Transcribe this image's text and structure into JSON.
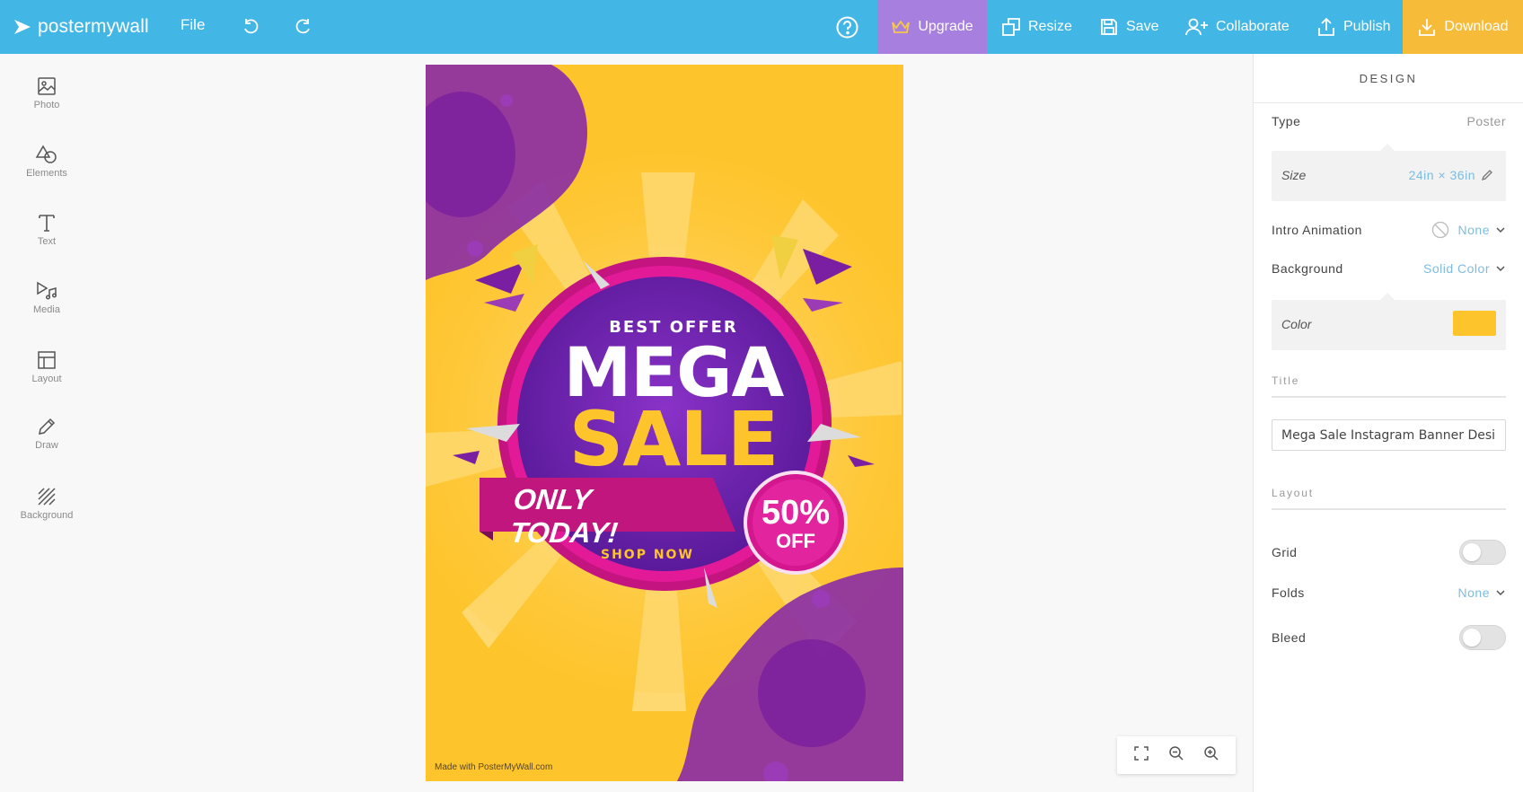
{
  "app": {
    "brand": "postermywall",
    "file_menu": "File"
  },
  "toolbar": {
    "upgrade": "Upgrade",
    "resize": "Resize",
    "save": "Save",
    "collaborate": "Collaborate",
    "publish": "Publish",
    "download": "Download"
  },
  "sidebar": {
    "items": [
      {
        "label": "Photo",
        "icon": "image-icon"
      },
      {
        "label": "Elements",
        "icon": "shapes-icon"
      },
      {
        "label": "Text",
        "icon": "text-icon"
      },
      {
        "label": "Media",
        "icon": "media-icon"
      },
      {
        "label": "Layout",
        "icon": "layout-icon"
      },
      {
        "label": "Draw",
        "icon": "pencil-icon"
      },
      {
        "label": "Background",
        "icon": "background-pattern-icon"
      }
    ]
  },
  "poster": {
    "best_offer": "BEST OFFER",
    "mega": "MEGA",
    "sale": "SALE",
    "only_today": "ONLY TODAY!",
    "percent": "50%",
    "off": "OFF",
    "shop_now": "SHOP NOW",
    "watermark": "Made with PosterMyWall.com"
  },
  "panel": {
    "heading": "DESIGN",
    "type_label": "Type",
    "type_value": "Poster",
    "size_label": "Size",
    "size_value": "24in × 36in",
    "intro_label": "Intro Animation",
    "intro_value": "None",
    "background_label": "Background",
    "background_value": "Solid Color",
    "color_label": "Color",
    "color_value": "#fec42b",
    "title_section": "Title",
    "title_value": "Mega Sale Instagram Banner Desi",
    "layout_section": "Layout",
    "grid_label": "Grid",
    "folds_label": "Folds",
    "folds_value": "None",
    "bleed_label": "Bleed"
  },
  "colors": {
    "topbar": "#42b6e5",
    "upgrade": "#a67fdf",
    "download": "#f7bb3a",
    "poster_bg": "#fec42b",
    "purple": "#7a1fa2",
    "magenta": "#d4168f",
    "link": "#7dbce0"
  }
}
